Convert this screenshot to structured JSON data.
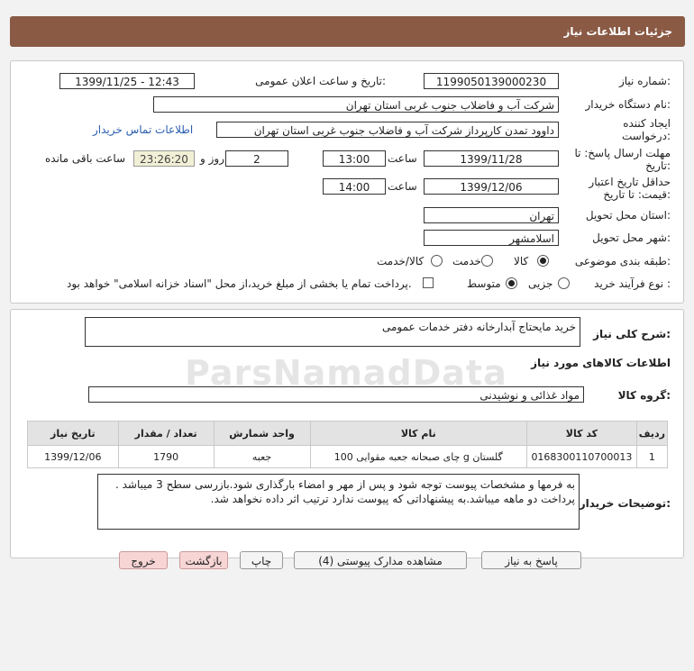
{
  "header": {
    "title": "جزئیات اطلاعات نیاز"
  },
  "form": {
    "need_number_label": "شماره نیاز:",
    "need_number": "1199050139000230",
    "announce_label": "تاریخ و ساعت اعلان عمومی:",
    "announce_value": "1399/11/25 - 12:43",
    "buyer_org_label": "نام دستگاه خریدار:",
    "buyer_org": "شرکت آب و فاضلاب جنوب غربی استان تهران",
    "creator_label": "ایجاد کننده درخواست:",
    "creator_value": "داوود  تمدن  کارپرداز شرکت آب و فاضلاب جنوب غربی استان تهران",
    "contact_link": "اطلاعات تماس خریدار",
    "reply_deadline_label": "مهلت ارسال پاسخ: تا تاریخ:",
    "reply_date": "1399/11/28",
    "time_label": "ساعت",
    "reply_time": "13:00",
    "days_value": "2",
    "days_label": "روز و",
    "remaining_time": "23:26:20",
    "remaining_label": "ساعت باقی مانده",
    "price_validity_label": "حداقل تاریخ اعتبار قیمت: تا تاریخ:",
    "price_date": "1399/12/06",
    "price_time": "14:00",
    "province_label": "استان محل تحویل:",
    "province": "تهران",
    "city_label": "شهر محل تحویل:",
    "city": "اسلامشهر",
    "category_label": "طبقه بندی موضوعی:",
    "category_options": [
      "کالا",
      "خدمت",
      "کالا/خدمت"
    ],
    "category_selected": "کالا",
    "process_label": "نوع فرآیند خرید :",
    "process_options": [
      "جزیی",
      "متوسط"
    ],
    "process_selected": "متوسط",
    "payment_note": "پرداخت تمام یا بخشی از مبلغ خرید،از محل \"اسناد خزانه اسلامی\" خواهد بود."
  },
  "details": {
    "need_desc_label": "شرح کلی نیاز:",
    "need_desc": "خرید مایحتاج آبدارخانه دفتر خدمات عمومی",
    "goods_info_title": "اطلاعات کالاهای مورد نیاز",
    "goods_group_label": "گروه کالا:",
    "goods_group": "مواد غذائی و نوشیدنی",
    "table": {
      "headers": [
        "ردیف",
        "کد کالا",
        "نام کالا",
        "واحد شمارش",
        "تعداد / مقدار",
        "تاریخ نیاز"
      ],
      "rows": [
        [
          "1",
          "0168300110700013",
          "چای صبحانه جعبه مقوایی 100 g گلستان",
          "جعبه",
          "1790",
          "1399/12/06"
        ]
      ]
    },
    "buyer_notes_label": "توضیحات خریدار:",
    "buyer_notes": "به فرمها و مشخصات پیوست توجه شود و پس از مهر و امضاء بارگذاری شود.بازرسی سطح 3 میباشد . پرداخت دو ماهه میباشد.به پیشنهاداتی که پیوست ندارد ترتیب اثر داده نخواهد شد."
  },
  "buttons": {
    "reply": "پاسخ به نیاز",
    "attachments": "مشاهده مدارک پیوستی (4)",
    "print": "چاپ",
    "back": "بازگشت",
    "exit": "خروج"
  },
  "watermark": "ParsNamadData"
}
